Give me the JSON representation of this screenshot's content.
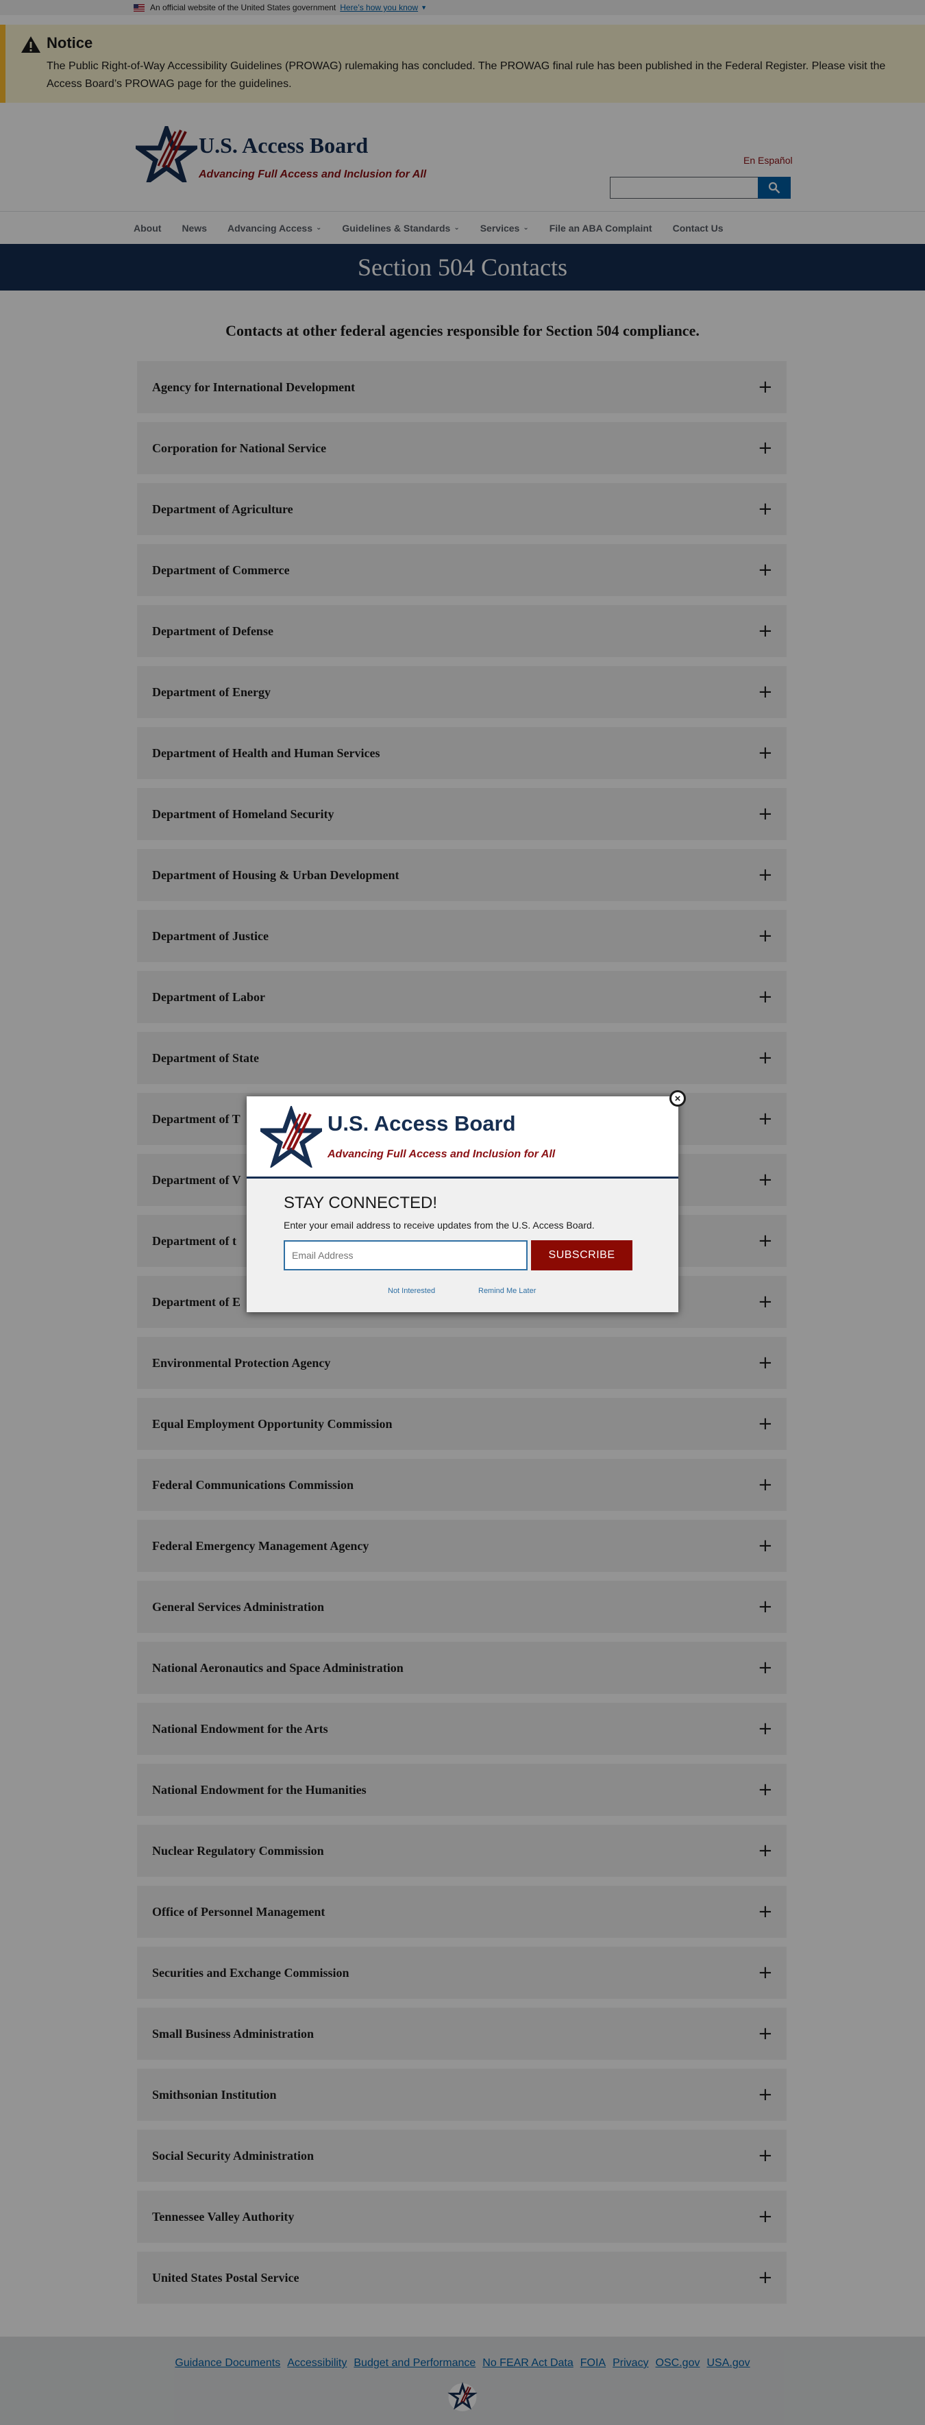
{
  "gov_banner": {
    "text": "An official website of the United States government",
    "link": "Here’s how you know"
  },
  "notice": {
    "title": "Notice",
    "body": "The Public Right-of-Way Accessibility Guidelines (PROWAG) rulemaking has concluded. The PROWAG final rule has been published in the Federal Register. Please visit the Access Board’s PROWAG page for the guidelines."
  },
  "header": {
    "title": "U.S. Access Board",
    "tagline": "Advancing Full Access and Inclusion for All",
    "espanol": "En Español",
    "search_value": ""
  },
  "nav": {
    "items": [
      {
        "label": "About",
        "dropdown": false
      },
      {
        "label": "News",
        "dropdown": false
      },
      {
        "label": "Advancing Access",
        "dropdown": true
      },
      {
        "label": "Guidelines & Standards",
        "dropdown": true
      },
      {
        "label": "Services",
        "dropdown": true
      },
      {
        "label": "File an ABA Complaint",
        "dropdown": false
      },
      {
        "label": "Contact Us",
        "dropdown": false
      }
    ]
  },
  "page": {
    "title": "Section 504 Contacts",
    "intro": "Contacts at other federal agencies responsible for Section 504 compliance."
  },
  "agencies": [
    "Agency for International Development",
    "Corporation for National Service",
    "Department of Agriculture",
    "Department of Commerce",
    "Department of Defense",
    "Department of Energy",
    "Department of Health and Human Services",
    "Department of Homeland Security",
    "Department of Housing & Urban Development",
    "Department of Justice",
    "Department of Labor",
    "Department of State",
    "Department of T",
    "Department of V",
    "Department of t",
    "Department of E",
    "Environmental Protection Agency",
    "Equal Employment Opportunity Commission",
    "Federal Communications Commission",
    "Federal Emergency Management Agency",
    "General Services Administration",
    "National Aeronautics and Space Administration",
    "National Endowment for the Arts",
    "National Endowment for the Humanities",
    "Nuclear Regulatory Commission",
    "Office of Personnel Management",
    "Securities and Exchange Commission",
    "Small Business Administration",
    "Smithsonian Institution",
    "Social Security Administration",
    "Tennessee Valley Authority",
    "United States Postal Service"
  ],
  "footer": {
    "links": [
      "Guidance Documents",
      "Accessibility",
      "Budget and Performance",
      "No FEAR Act Data",
      "FOIA",
      "Privacy",
      "OSC.gov",
      "USA.gov"
    ]
  },
  "modal": {
    "title": "U.S. Access Board",
    "tagline": "Advancing Full Access and Inclusion for All",
    "heading": "STAY CONNECTED!",
    "subtext": "Enter your email address to receive updates from the U.S. Access Board.",
    "email_placeholder": "Email Address",
    "subscribe_label": "SUBSCRIBE",
    "not_interested": "Not Interested",
    "remind_later": "Remind Me Later",
    "close_glyph": "×"
  },
  "colors": {
    "navy": "#162e51",
    "maroon": "#8b1114",
    "link": "#005ea2",
    "notice_bg": "#faf3d1",
    "notice_border": "#ffbe2e"
  }
}
